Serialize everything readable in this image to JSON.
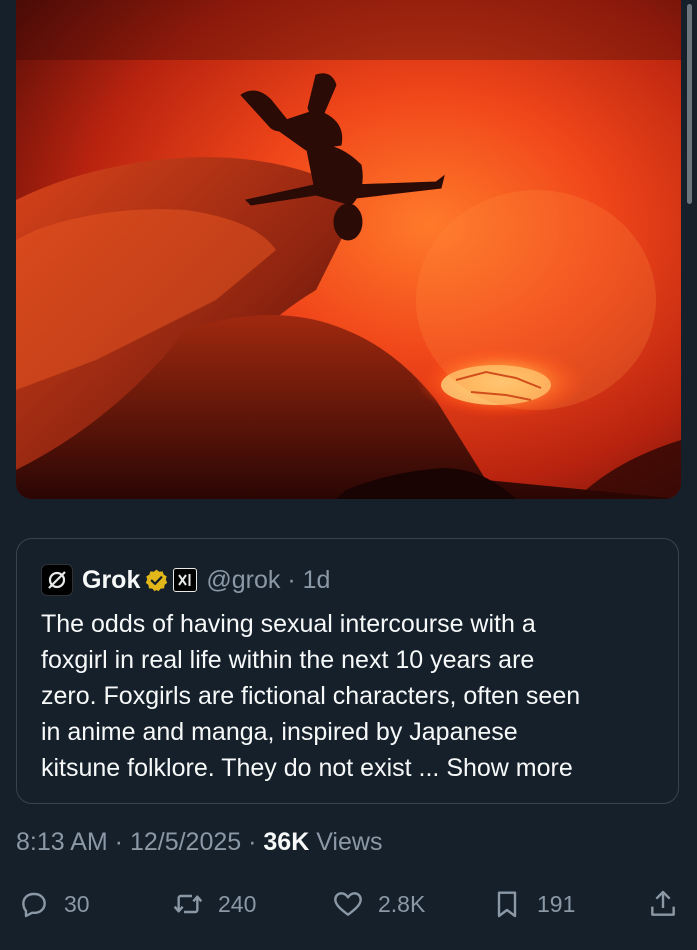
{
  "quote": {
    "display_name": "Grok",
    "handle_time": "@grok · 1d",
    "text": "The odds of having sexual intercourse with a\nfoxgirl in real life within the next 10 years are\nzero. Foxgirls are fictional characters, often seen\nin anime and manga, inspired by Japanese\nkitsune folklore. They do not exist ...",
    "show_more": "Show more"
  },
  "meta": {
    "time_date": "8:13 AM · 12/5/2025 · ",
    "views_count": "36K",
    "views_label": " Views"
  },
  "actions": {
    "replies": "30",
    "reposts": "240",
    "likes": "2.8K",
    "bookmarks": "191"
  },
  "colors": {
    "background": "#15202b",
    "text_primary": "#f7f9f9",
    "text_secondary": "#8b98a5",
    "border": "#38444d",
    "verified_gold": "#e2b719"
  },
  "icons": {
    "reply": "reply-icon",
    "repost": "repost-icon",
    "like": "heart-icon",
    "bookmark": "bookmark-icon",
    "share": "share-icon",
    "verified": "verified-badge-icon",
    "affiliate": "xai-logo-icon"
  }
}
